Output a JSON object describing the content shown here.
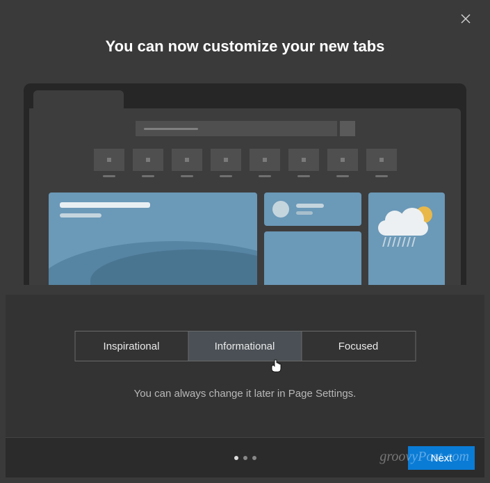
{
  "header": {
    "title": "You can now customize your new tabs",
    "close_icon": "close-icon"
  },
  "layout_options": {
    "items": [
      {
        "label": "Inspirational",
        "selected": false
      },
      {
        "label": "Informational",
        "selected": true
      },
      {
        "label": "Focused",
        "selected": false
      }
    ]
  },
  "subtitle": "You can always change it later in Page Settings.",
  "footer": {
    "pager": {
      "total": 3,
      "active_index": 0
    },
    "next_label": "Next"
  },
  "watermark": "groovyPost.com",
  "preview": {
    "weather_icon": "partly-cloudy-rain",
    "speed_dial_count": 8
  }
}
